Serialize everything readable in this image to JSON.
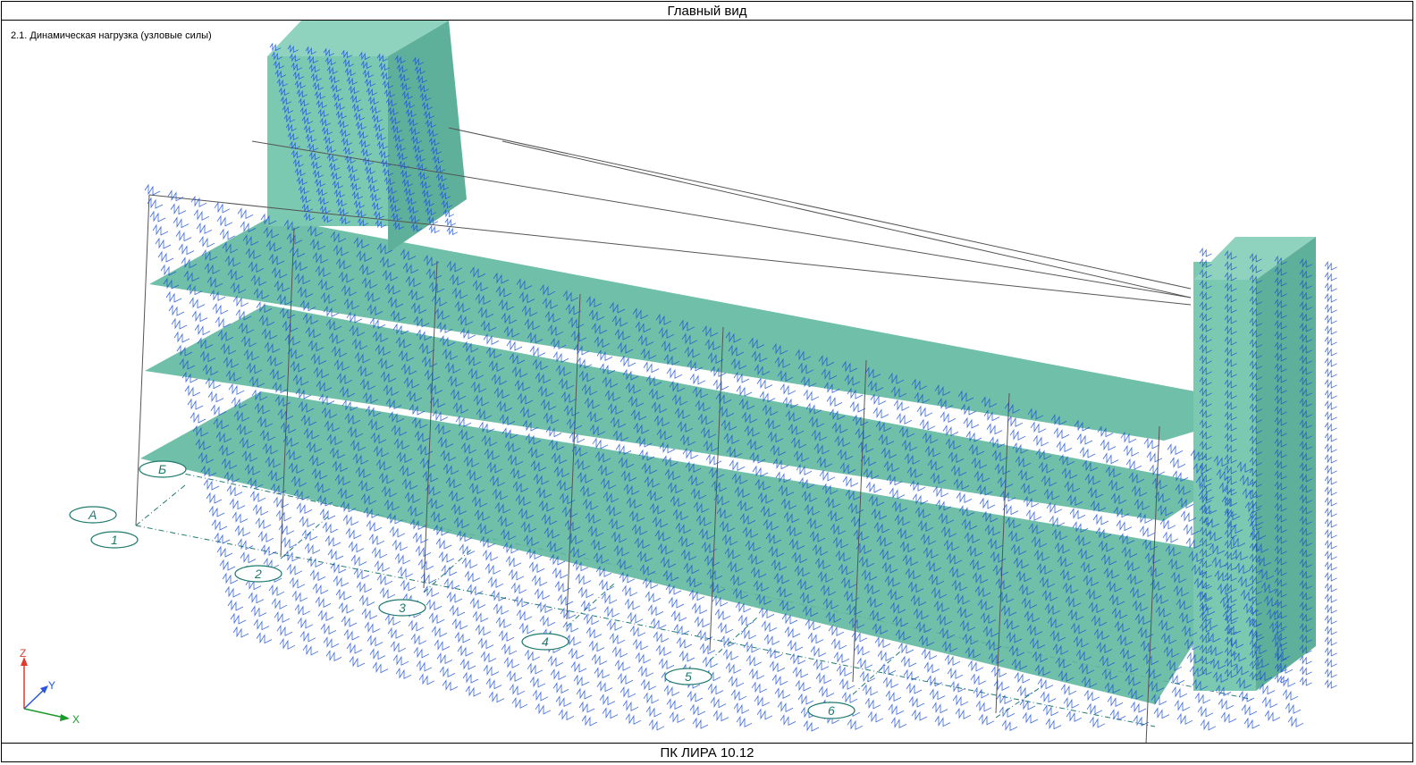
{
  "window": {
    "title": "Главный вид",
    "status": "ПК ЛИРА 10.12"
  },
  "viewport": {
    "load_case": "2.1. Динамическая нагрузка (узловые силы)"
  },
  "axes": {
    "z": "Z",
    "y": "Y",
    "x": "X"
  },
  "grid_axes": {
    "letters": [
      "А",
      "Б"
    ],
    "numbers": [
      "1",
      "2",
      "3",
      "4",
      "5",
      "6"
    ]
  },
  "colors": {
    "slab_fill": "#5fb8a0",
    "load_arrows": "#1a4fd6",
    "frame_lines": "#555555",
    "grid_line": "#1f7a6e",
    "axis_z": "#e03c2a",
    "axis_y": "#2a55e0",
    "axis_x": "#1a9a2a"
  }
}
